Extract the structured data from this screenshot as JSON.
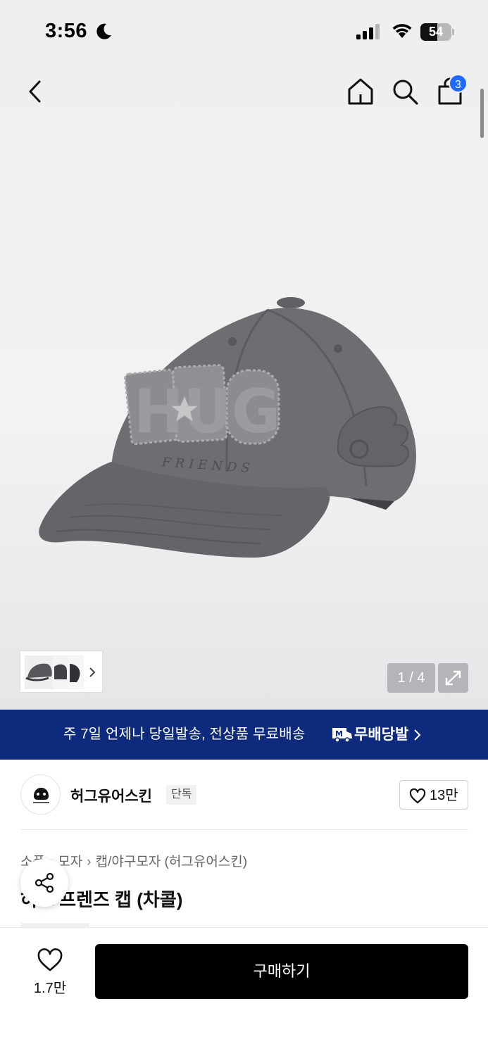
{
  "status_bar": {
    "time": "3:56",
    "battery_percent": "54",
    "battery_level": 0.54,
    "icons": [
      "moon-icon",
      "signal-icon",
      "wifi-icon",
      "battery-icon"
    ]
  },
  "header": {
    "icons": [
      "back-icon",
      "home-icon",
      "search-icon",
      "cart-icon"
    ],
    "cart_count": "3"
  },
  "gallery": {
    "image_text": "HUG",
    "image_subtext": "FRIENDS",
    "counter": "1 / 4",
    "thumbnail_count": 3
  },
  "promo_banner": {
    "text": "주 7일 언제나 당일발송, 전상품 무료배송",
    "logo_text": "무배당발",
    "background": "#0d2a7c"
  },
  "brand": {
    "name": "허그유어스킨",
    "tag": "단독",
    "likes": "13만",
    "logo_text": "hugyourskin"
  },
  "breadcrumb": [
    "소품",
    "모자",
    "캡/야구모자 (허그유어스킨)"
  ],
  "product": {
    "title": "허그 프렌즈 캡 (차콜)"
  },
  "bottom_bar": {
    "wish_count": "1.7만",
    "buy_label": "구매하기"
  },
  "colors": {
    "accent_badge": "#1f6bff",
    "buy_button": "#000000"
  }
}
